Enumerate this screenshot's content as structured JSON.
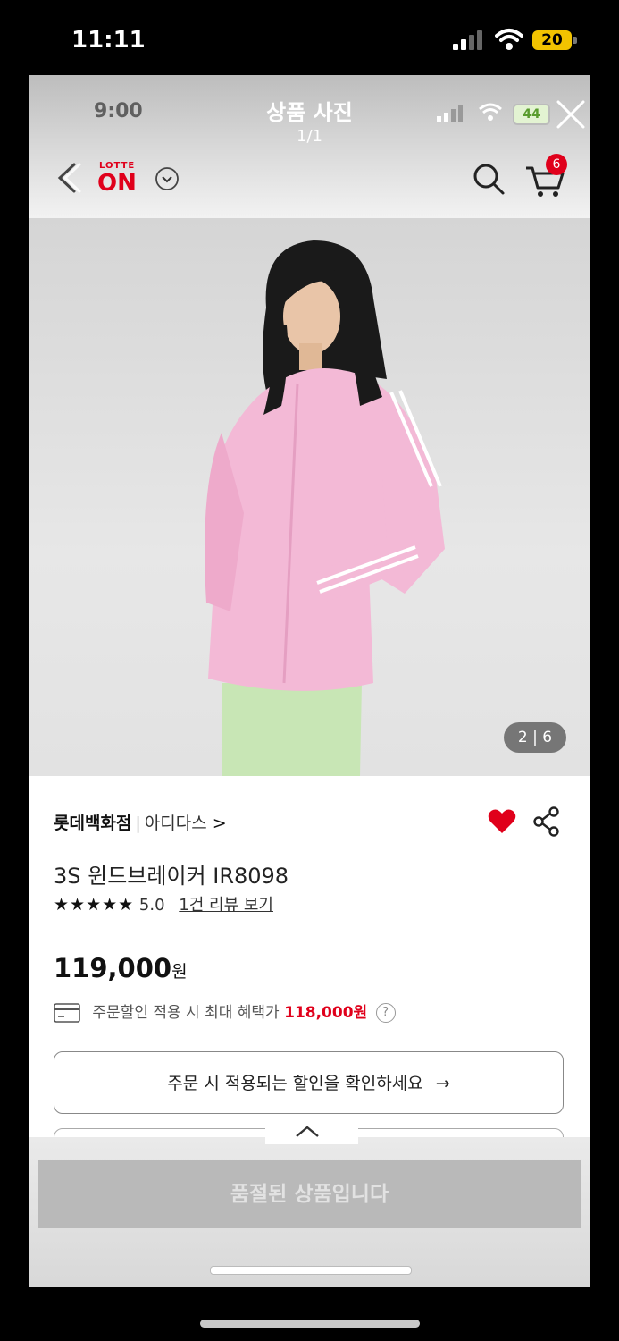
{
  "status_bar": {
    "time": "11:11",
    "battery": "20"
  },
  "viewer": {
    "inner_time": "9:00",
    "title": "상품 사진",
    "counter": "1/1",
    "inner_battery": "44"
  },
  "app_bar": {
    "logo_small": "LOTTE",
    "logo_big": "ON",
    "cart_count": "6"
  },
  "product": {
    "image_counter": "2 | 6",
    "store": "롯데백화점",
    "brand": "아디다스",
    "brand_arrow": ">",
    "name": "3S 윈드브레이커 IR8098",
    "stars": "★★★★★",
    "rating": "5.0",
    "review_link": "1건 리뷰 보기",
    "price": "119,000",
    "price_unit": "원",
    "benefit_text": "주문할인 적용 시 최대 혜택가",
    "benefit_price": "118,000원",
    "help": "?"
  },
  "discount_button": {
    "label": "주문 시 적용되는 할인을 확인하세요",
    "arrow": "→"
  },
  "soldout_button": {
    "label": "품절된 상품입니다"
  },
  "colors": {
    "accent": "#e0001b",
    "heart": "#e0001b"
  }
}
